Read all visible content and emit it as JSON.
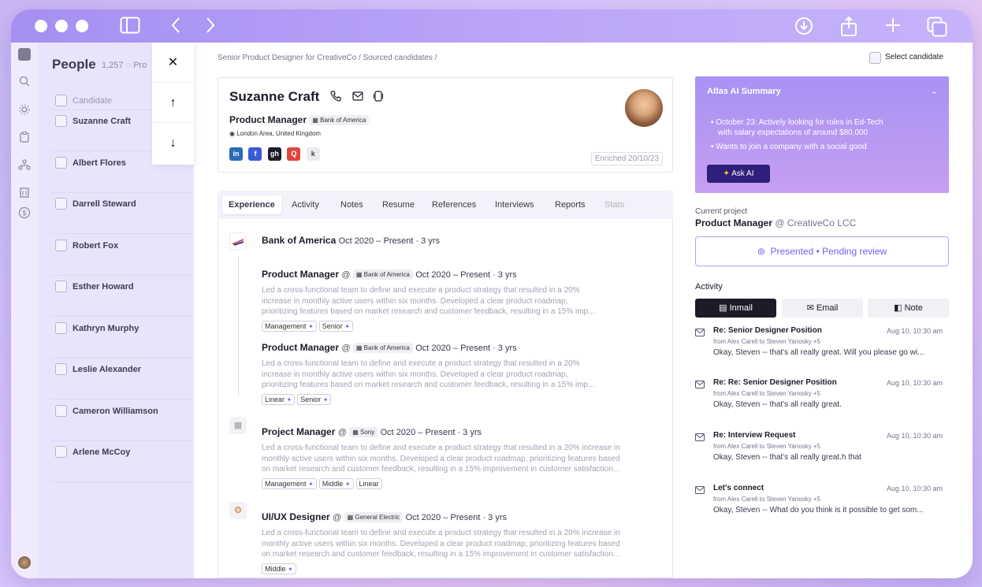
{
  "titlebar": {},
  "people": {
    "title": "People",
    "count": "1,257",
    "count_suffix": "Pro",
    "header": "Candidate",
    "items": [
      "Suzanne Craft",
      "Albert Flores",
      "Darrell Steward",
      "Robert Fox",
      "Esther Howard",
      "Kathryn Murphy",
      "Leslie Alexander",
      "Cameron Williamson",
      "Arlene McCoy"
    ]
  },
  "nav": {
    "close": "✕",
    "up": "↑",
    "down": "↓"
  },
  "breadcrumb": "Senior Product Designer for CreativeCo / Sourced candidates /",
  "select_candidate": "Select candidate",
  "profile": {
    "name": "Suzanne Craft",
    "role": "Product Manager",
    "company": "Bank of America",
    "location": "London Area, United Kingdom",
    "enriched": "Enriched 20/10/23",
    "socials": [
      "in",
      "f",
      "gh",
      "Q",
      "k"
    ]
  },
  "tabs": [
    "Experience",
    "Activity",
    "Notes",
    "Resume",
    "References",
    "Interviews",
    "Reports",
    "Stats"
  ],
  "experience": {
    "company1": "Bank of America",
    "company1_dates": "Oct 2020 – Present · 3 yrs",
    "roles": [
      {
        "title": "Product Manager",
        "company": "Bank of America",
        "dates": "Oct 2020 – Present · 3 yrs",
        "desc1": "Led a cross-functional team to define and execute a product strategy that resulted in a 20%",
        "desc2": "increase in monthly active users within six months. Developed a clear product roadmap,",
        "desc3": "prioritizing features based on market research and customer feedback, resulting in a 15% imp...",
        "tags": [
          "Management",
          "Senior"
        ]
      },
      {
        "title": "Product Manager",
        "company": "Bank of America",
        "dates": "Oct 2020 – Present · 3 yrs",
        "desc1": "Led a cross-functional team to define and execute a product strategy that resulted in a 20%",
        "desc2": "increase in monthly active users within six months. Developed a clear product roadmap,",
        "desc3": "prioritizing features based on market research and customer feedback, resulting in a 15% imp...",
        "tags": [
          "Linear",
          "Senior"
        ]
      },
      {
        "title": "Project Manager",
        "company": "Sony",
        "dates": "Oct 2020 – Present · 3 yrs",
        "desc1": "Led a cross-functional team to define and execute a product strategy that resulted in a 20% increase in",
        "desc2": "monthly active users within six months. Developed a clear product roadmap, prioritizing features based",
        "desc3": "on market research and customer feedback, resulting in a 15% improvement in customer satisfaction...",
        "tags": [
          "Management",
          "Middle",
          "Linear"
        ]
      },
      {
        "title": "UI/UX Designer",
        "company": "General Electric",
        "dates": "Oct 2020 – Present · 3 yrs",
        "desc1": "Led a cross-functional team to define and execute a product strategy that resulted in a 20% increase in",
        "desc2": "monthly active users within six months. Developed a clear product roadmap, prioritizing features based",
        "desc3": "on market research and customer feedback, resulting in a 15% improvement in customer satisfaction...",
        "tags": [
          "Middle"
        ]
      }
    ]
  },
  "atlas": {
    "title": "Atlas AI Summary",
    "line1": "October 23: Actively looking for roles in Ed-Tech",
    "line1b": "with salary expectations of around $80,000",
    "line2": "Wants to join a company with a social good",
    "ask": "Ask AI"
  },
  "current_project": {
    "label": "Current project",
    "title": "Product Manager",
    "company": "@ CreativeCo LCC",
    "status": "Presented • Pending review"
  },
  "activity": {
    "label": "Activity",
    "buttons": [
      "Inmail",
      "Email",
      "Note"
    ],
    "messages": [
      {
        "title": "Re: Senior Designer Position",
        "time": "Aug 10, 10:30 am",
        "from": "from Alex Carell   to Steven Yanosky +5",
        "body": "Okay, Steven -- that's all really great. Will you please go wi..."
      },
      {
        "title": "Re: Re: Senior Designer Position",
        "time": "Aug 10, 10:30 am",
        "from": "from Alex Carell   to Steven Yanosky +5",
        "body": "Okay, Steven -- that's all really great."
      },
      {
        "title": "Re: Interview Request",
        "time": "Aug 10, 10:30 am",
        "from": "from Alex Carell   to Steven Yanosky +5",
        "body": "Okay, Steven -- that's all really great.h that"
      },
      {
        "title": "Let's connect",
        "time": "Aug 10, 10:30 am",
        "from": "from Alex Carell   to Steven Yanosky +5",
        "body": "Okay, Steven -- What do you think is it possible to get som..."
      }
    ]
  }
}
